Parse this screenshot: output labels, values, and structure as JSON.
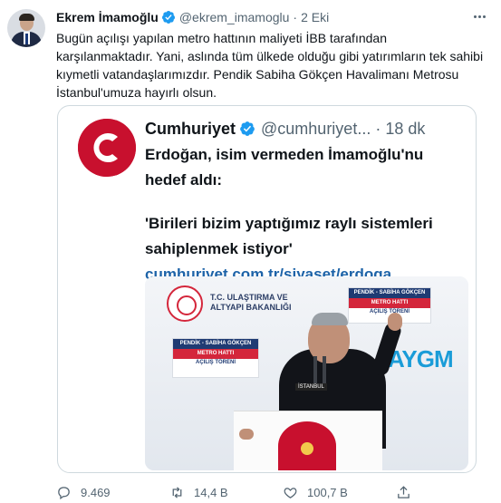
{
  "tweet": {
    "author_name": "Ekrem İmamoğlu",
    "author_handle": "@ekrem_imamoglu",
    "separator": "·",
    "timestamp": "2 Eki",
    "text_lines": [
      "Bugün açılışı yapılan metro hattının maliyeti İBB tarafından",
      "karşılanmaktadır. Yani, aslında tüm ülkede olduğu gibi yatırımların tek sahibi",
      "kıymetli vatandaşlarımızdır. Pendik Sabiha Gökçen Havalimanı Metrosu",
      "İstanbul'umuza hayırlı olsun."
    ]
  },
  "quote": {
    "author_name": "Cumhuriyet",
    "author_handle": "@cumhuriyet...",
    "separator": "·",
    "timestamp": "18 dk",
    "headline_lines": [
      "Erdoğan, isim vermeden İmamoğlu'nu",
      "hedef aldı:"
    ],
    "quote_lines": [
      "'Birileri bizim yaptığımız raylı sistemleri",
      "sahiplenmek istiyor'"
    ],
    "link": "cumhuriyet.com.tr/siyaset/erdoga...",
    "photo": {
      "ministry_lines": [
        "T.C. ULAŞTIRMA VE",
        "ALTYAPI BAKANLIĞI"
      ],
      "sign_top_lines": [
        "PENDİK - SABİHA GÖKÇEN",
        "METRO HATTI",
        "AÇILIŞ TÖRENİ"
      ],
      "sign_left_lines": [
        "PENDİK - SABİHA GÖKÇEN",
        "METRO HATTI",
        "AÇILIŞ TÖRENİ"
      ],
      "brand_text": "AYGM",
      "podium_label": "İSTANBUL"
    }
  },
  "actions": {
    "replies": "9.469",
    "retweets": "14,4 B",
    "likes": "100,7 B"
  },
  "colors": {
    "verified": "#1d9bf0",
    "link": "#1d63a8",
    "muted": "#536471",
    "cumhuriyet_red": "#c8102e"
  },
  "icons": [
    "verified-badge-icon",
    "more-options-icon",
    "reply-icon",
    "retweet-icon",
    "like-icon",
    "share-icon"
  ]
}
